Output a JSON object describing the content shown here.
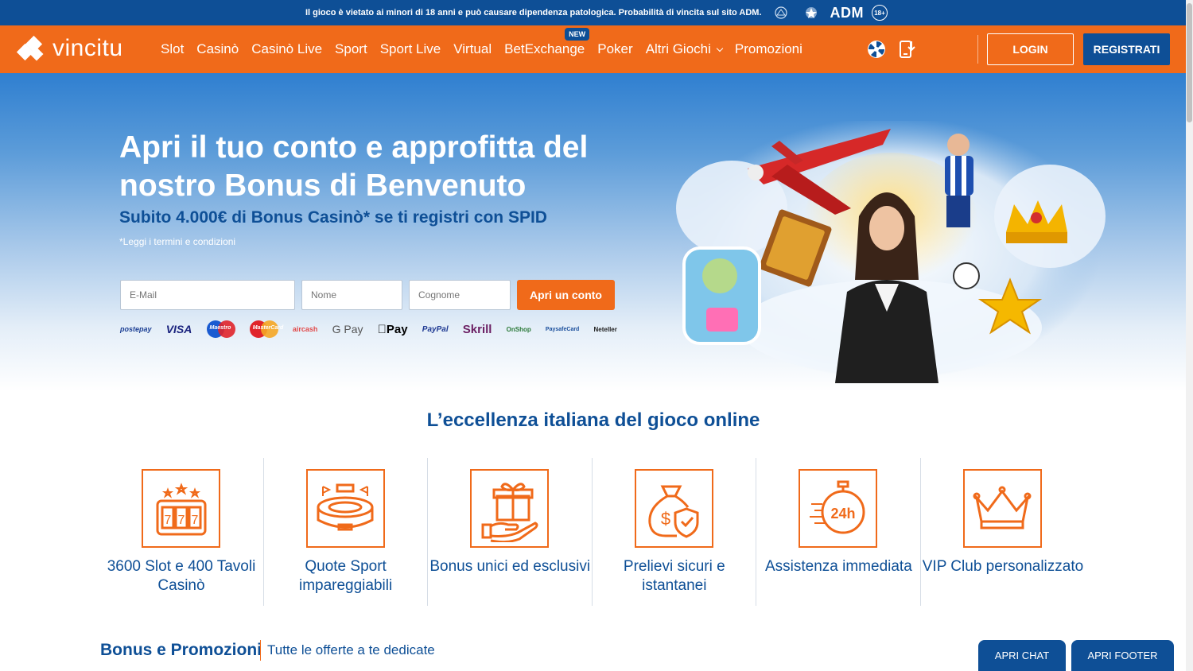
{
  "colors": {
    "brand_orange": "#f06a1a",
    "brand_blue": "#0e4f96",
    "white": "#ffffff"
  },
  "topbar": {
    "notice": "Il gioco è vietato ai minori di 18 anni e può causare dipendenza patologica. Probabilità di vincita sul sito ADM.",
    "adm_label": "ADM",
    "age_label": "18+"
  },
  "nav": {
    "logo_text": "vincitu",
    "items": [
      "Slot",
      "Casinò",
      "Casinò Live",
      "Sport",
      "Sport Live",
      "Virtual",
      "BetExchange",
      "Poker",
      "Altri Giochi",
      "Promozioni"
    ],
    "new_badge": "NEW",
    "login_label": "LOGIN",
    "register_label": "REGISTRATI",
    "icons": [
      "wheel-icon",
      "mobile-download-icon"
    ]
  },
  "hero": {
    "title": "Apri il tuo conto e approfitta del nostro Bonus di Benvenuto",
    "subtitle": "Subito 4.000€ di Bonus Casinò* se ti registri con SPID",
    "terms": "*Leggi i termini e condizioni",
    "email_placeholder": "E-Mail",
    "nome_placeholder": "Nome",
    "cognome_placeholder": "Cognome",
    "cta_label": "Apri un conto",
    "payments": [
      "postepay",
      "VISA",
      "Maestro",
      "MasterCard",
      "aircash",
      "G Pay",
      "Pay",
      "PayPal",
      "Skrill",
      "OnShop",
      "PaysafeCard",
      "Neteller"
    ]
  },
  "features": {
    "title": "L’eccellenza italiana del gioco online",
    "items": [
      {
        "label": "3600 Slot e 400 Tavoli Casinò",
        "icon": "slot-machine-icon"
      },
      {
        "label": "Quote Sport impareggiabili",
        "icon": "stadium-icon"
      },
      {
        "label": "Bonus unici ed esclusivi",
        "icon": "gift-hand-icon"
      },
      {
        "label": "Prelievi sicuri e istantanei",
        "icon": "money-bag-shield-icon"
      },
      {
        "label": "Assistenza immediata",
        "icon": "stopwatch-24h-icon"
      },
      {
        "label": "VIP Club personalizzato",
        "icon": "crown-icon"
      }
    ]
  },
  "promo": {
    "title": "Bonus e Promozioni",
    "subtitle": "Tutte le offerte a te dedicate"
  },
  "floating": {
    "chat_label": "APRI CHAT",
    "footer_label": "APRI FOOTER"
  }
}
